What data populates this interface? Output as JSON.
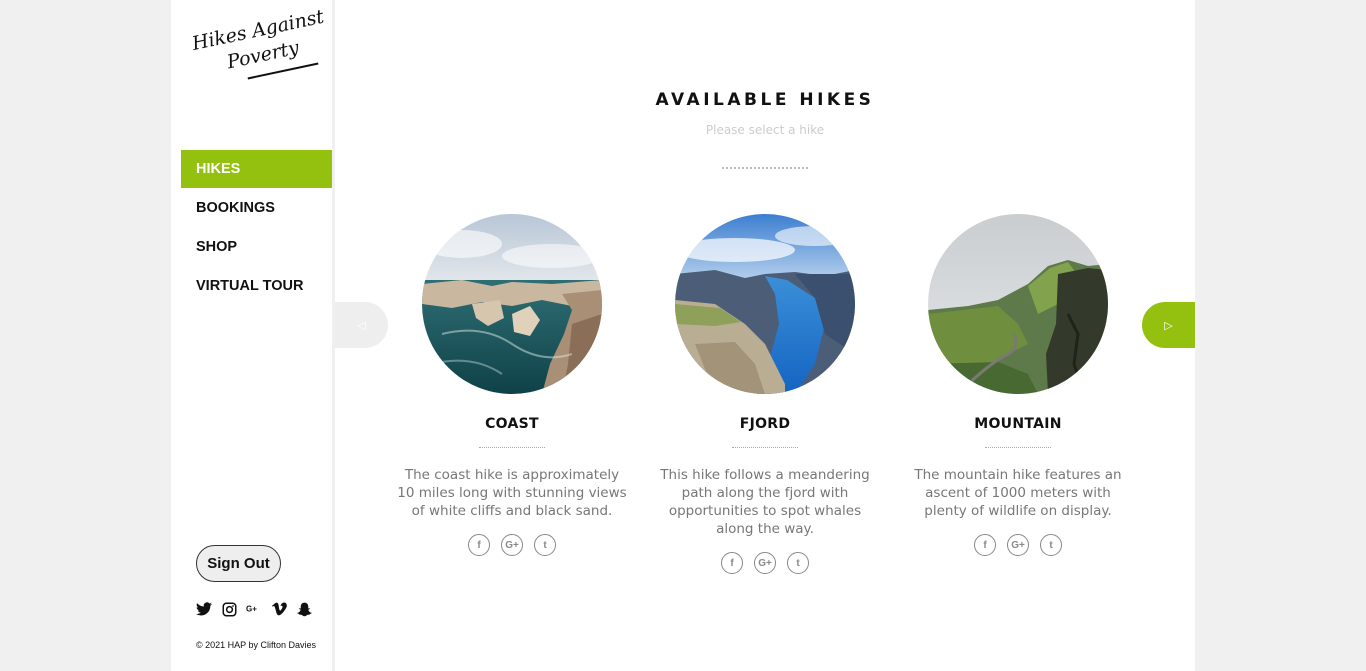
{
  "brand": {
    "logo_line1": "Hikes Against",
    "logo_line2": "Poverty"
  },
  "sidebar": {
    "items": [
      {
        "label": "HIKES",
        "active": true
      },
      {
        "label": "BOOKINGS",
        "active": false
      },
      {
        "label": "SHOP",
        "active": false
      },
      {
        "label": "VIRTUAL TOUR",
        "active": false
      }
    ],
    "sign_out_label": "Sign Out",
    "social_icons": [
      "twitter-icon",
      "instagram-icon",
      "google-plus-icon",
      "vimeo-icon",
      "snapchat-icon"
    ],
    "copyright": "© 2021 HAP by Clifton Davies"
  },
  "main": {
    "title": "AVAILABLE HIKES",
    "subtitle": "Please select a hike",
    "prev_icon": "◁",
    "next_icon": "▷",
    "cards": [
      {
        "title": "COAST",
        "description": "The coast hike is approximately 10 miles long with stunning views of white cliffs and black sand.",
        "share": [
          "f",
          "G+",
          "t"
        ]
      },
      {
        "title": "FJORD",
        "description": "This hike follows a meandering path along the fjord with opportunities to spot whales along the way.",
        "share": [
          "f",
          "G+",
          "t"
        ]
      },
      {
        "title": "MOUNTAIN",
        "description": "The mountain hike features an ascent of 1000 meters with plenty of wildlife on display.",
        "share": [
          "f",
          "G+",
          "t"
        ]
      }
    ]
  },
  "colors": {
    "accent": "#94c10f",
    "background": "#f0f0f0",
    "muted_text": "#777777"
  }
}
